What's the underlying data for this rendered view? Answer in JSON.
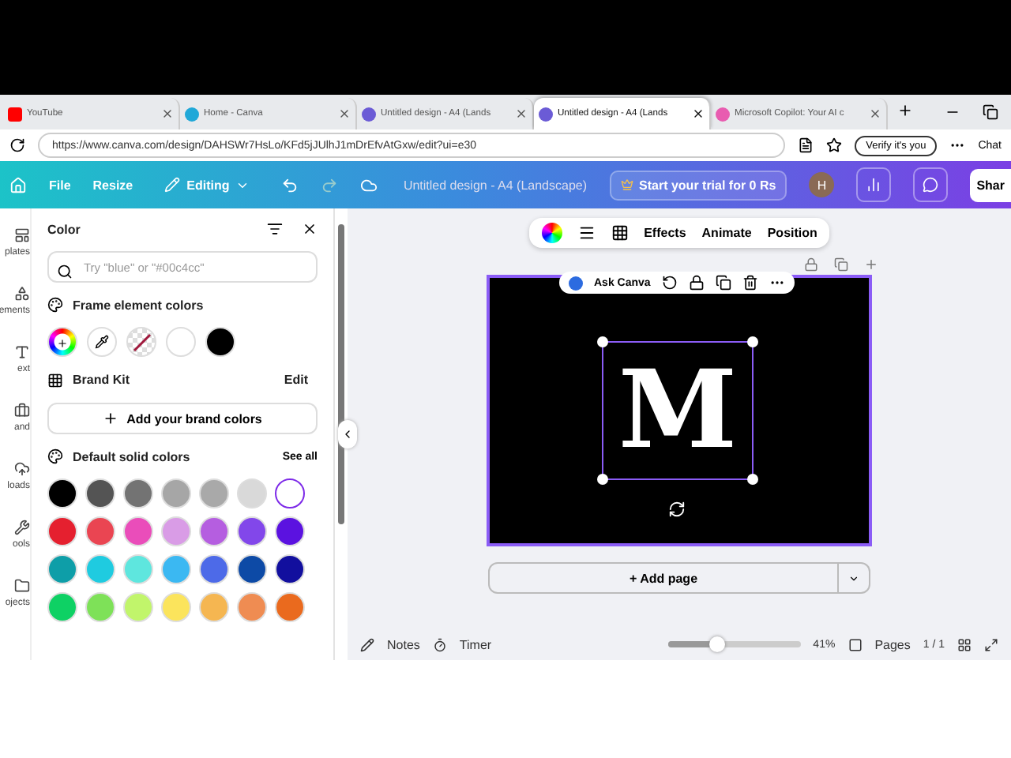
{
  "browser": {
    "tabs": [
      {
        "label": "YouTube",
        "selected": false
      },
      {
        "label": "Home - Canva",
        "selected": false
      },
      {
        "label": "Untitled design - A4 (Lands",
        "selected": false
      },
      {
        "label": "Untitled design - A4 (Lands",
        "selected": true
      },
      {
        "label": "Microsoft Copilot: Your AI c",
        "selected": false
      }
    ],
    "url": "https://www.canva.com/design/DAHSWr7HsLo/KFd5jJUlhJ1mDrEfvAtGxw/edit?ui=e30",
    "verify": "Verify it's you",
    "chat": "Chat"
  },
  "toolbar": {
    "file": "File",
    "resize": "Resize",
    "editing": "Editing",
    "title": "Untitled design - A4 (Landscape)",
    "trial": "Start your trial for 0 Rs",
    "avatar": "H",
    "share": "Shar"
  },
  "sidebar": {
    "items": [
      "plates",
      "ements",
      "ext",
      "and",
      "loads",
      "ools",
      "ojects"
    ]
  },
  "panel": {
    "title": "Color",
    "search": {
      "placeholder": "Try \"blue\" or \"#00c4cc\""
    },
    "frame_title": "Frame element colors",
    "frame_colors": [
      {
        "kind": "add"
      },
      {
        "kind": "picker"
      },
      {
        "kind": "none"
      },
      {
        "kind": "swatch",
        "color": "#ffffff"
      },
      {
        "kind": "swatch",
        "color": "#000000"
      }
    ],
    "brand_title": "Brand Kit",
    "brand_edit": "Edit",
    "add_brand": "Add your brand colors",
    "default_title": "Default solid colors",
    "see_all": "See all",
    "default_colors": [
      {
        "color": "#000000",
        "selected": false
      },
      {
        "color": "#545454",
        "selected": false
      },
      {
        "color": "#737373",
        "selected": false
      },
      {
        "color": "#a6a6a6",
        "selected": false
      },
      {
        "color": "#a9a9a9",
        "selected": false
      },
      {
        "color": "#d9d9d9",
        "selected": false
      },
      {
        "color": "#ffffff",
        "selected": true
      },
      {
        "color": "#e5202f",
        "selected": false
      },
      {
        "color": "#ea4552",
        "selected": false
      },
      {
        "color": "#ea4dba",
        "selected": false
      },
      {
        "color": "#d99ce6",
        "selected": false
      },
      {
        "color": "#b55ee0",
        "selected": false
      },
      {
        "color": "#8247ea",
        "selected": false
      },
      {
        "color": "#5b12e0",
        "selected": false
      },
      {
        "color": "#0e9ea8",
        "selected": false
      },
      {
        "color": "#1fcbe0",
        "selected": false
      },
      {
        "color": "#5ee6de",
        "selected": false
      },
      {
        "color": "#3bb8f2",
        "selected": false
      },
      {
        "color": "#4d6ae8",
        "selected": false
      },
      {
        "color": "#0d4aa6",
        "selected": false
      },
      {
        "color": "#120f9e",
        "selected": false
      },
      {
        "color": "#0ed164",
        "selected": false
      },
      {
        "color": "#7ee158",
        "selected": false
      },
      {
        "color": "#c1f56b",
        "selected": false
      },
      {
        "color": "#fbe45c",
        "selected": false
      },
      {
        "color": "#f5b651",
        "selected": false
      },
      {
        "color": "#ef8c52",
        "selected": false
      },
      {
        "color": "#ea6a1e",
        "selected": false
      }
    ]
  },
  "context_bar": {
    "items": [
      "Effects",
      "Animate",
      "Position"
    ]
  },
  "ask_canva": "Ask Canva",
  "design": {
    "letter": "M"
  },
  "add_page": "+ Add page",
  "footer": {
    "notes": "Notes",
    "timer": "Timer",
    "zoom": {
      "level": 0.37,
      "reading": "41%"
    },
    "pages": "Pages",
    "page_count": "1 / 1"
  }
}
